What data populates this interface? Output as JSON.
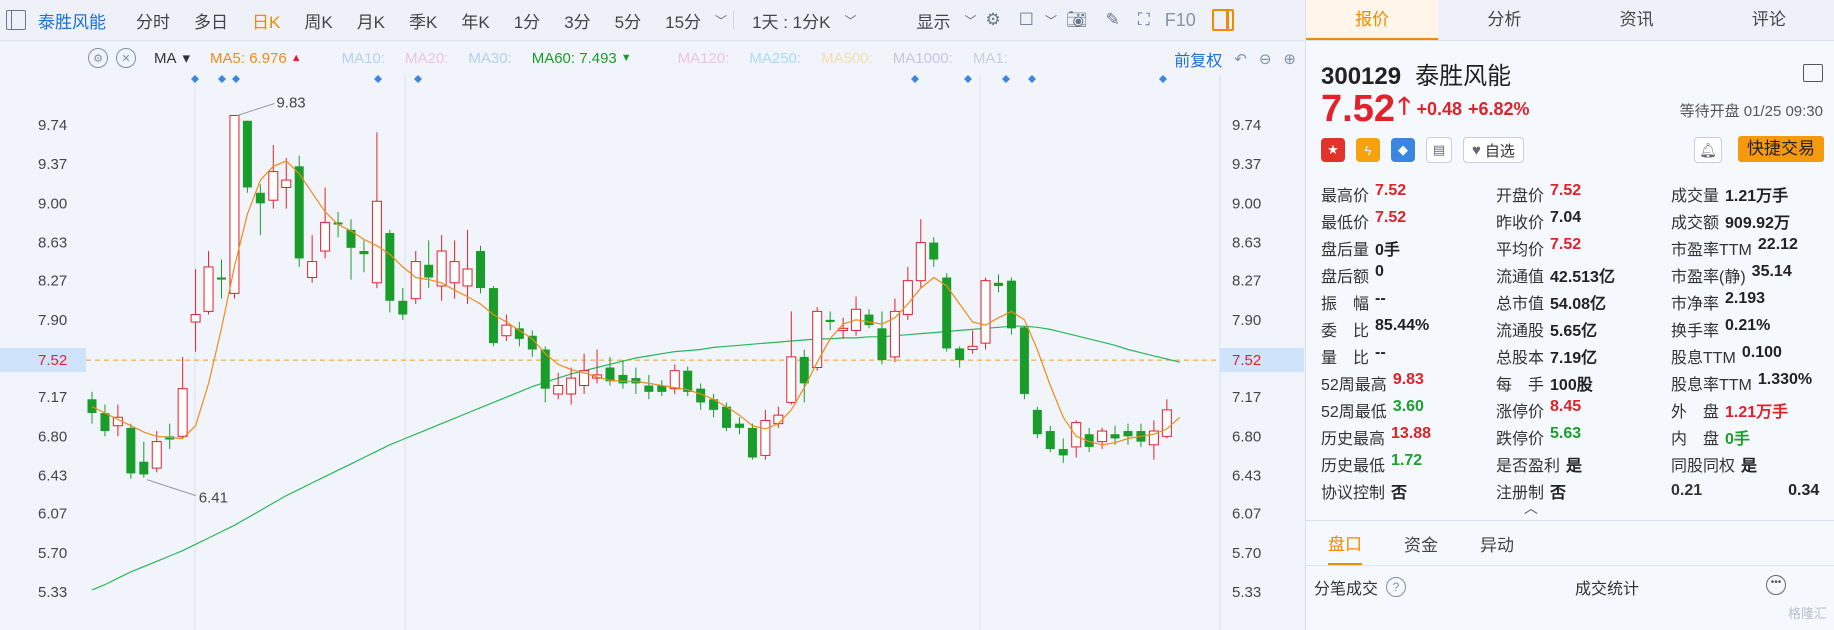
{
  "topbar": {
    "stock_name": "泰胜风能",
    "periods": [
      "分时",
      "多日",
      "日K",
      "周K",
      "月K",
      "季K",
      "年K",
      "1分",
      "3分",
      "5分",
      "15分"
    ],
    "active_period": "日K",
    "range_label": "1天 : 1分K",
    "display_label": "显示",
    "f10_label": "F10"
  },
  "indicator_bar": {
    "type_label": "MA",
    "ma5": "MA5: 6.976",
    "ma10": "MA10:",
    "ma20": "MA20:",
    "ma30": "MA30:",
    "ma60": "MA60: 7.493",
    "ma120": "MA120:",
    "ma250": "MA250:",
    "ma500": "MA500:",
    "ma1000": "MA1000:",
    "ma1x": "MA1:",
    "adjust_label": "前复权"
  },
  "chart_data": {
    "type": "candlestick",
    "y_ticks": [
      "9.74",
      "9.37",
      "9.00",
      "8.63",
      "8.27",
      "7.90",
      "7.52",
      "7.17",
      "6.80",
      "6.43",
      "6.07",
      "5.70",
      "5.33"
    ],
    "ylim": [
      5.33,
      9.74
    ],
    "current_price_label": "7.52",
    "high_annotation": "9.83",
    "low_annotation": "6.41",
    "colors": {
      "up": "#e0222b",
      "down": "#1a9c2a",
      "ma5": "#f08a18",
      "ma60": "#2ab55a"
    },
    "candles": [
      {
        "o": 7.15,
        "c": 7.02,
        "h": 7.22,
        "l": 6.92
      },
      {
        "o": 7.02,
        "c": 6.85,
        "h": 7.1,
        "l": 6.8
      },
      {
        "o": 6.9,
        "c": 6.98,
        "h": 7.1,
        "l": 6.8
      },
      {
        "o": 6.88,
        "c": 6.45,
        "h": 6.92,
        "l": 6.4
      },
      {
        "o": 6.56,
        "c": 6.44,
        "h": 6.75,
        "l": 6.41
      },
      {
        "o": 6.5,
        "c": 6.75,
        "h": 6.85,
        "l": 6.46
      },
      {
        "o": 6.8,
        "c": 6.77,
        "h": 6.92,
        "l": 6.68
      },
      {
        "o": 6.8,
        "c": 7.25,
        "h": 7.55,
        "l": 6.78
      },
      {
        "o": 7.88,
        "c": 7.95,
        "h": 8.38,
        "l": 7.6
      },
      {
        "o": 7.98,
        "c": 8.4,
        "h": 8.55,
        "l": 7.95
      },
      {
        "o": 8.3,
        "c": 8.28,
        "h": 8.47,
        "l": 8.1
      },
      {
        "o": 8.15,
        "c": 9.83,
        "h": 9.83,
        "l": 8.1
      },
      {
        "o": 9.78,
        "c": 9.15,
        "h": 9.78,
        "l": 9.1
      },
      {
        "o": 9.1,
        "c": 9.0,
        "h": 9.18,
        "l": 8.7
      },
      {
        "o": 9.03,
        "c": 9.3,
        "h": 9.55,
        "l": 8.95
      },
      {
        "o": 9.15,
        "c": 9.22,
        "h": 9.43,
        "l": 8.95
      },
      {
        "o": 9.35,
        "c": 8.48,
        "h": 9.45,
        "l": 8.4
      },
      {
        "o": 8.3,
        "c": 8.45,
        "h": 8.7,
        "l": 8.25
      },
      {
        "o": 8.55,
        "c": 8.82,
        "h": 9.15,
        "l": 8.48
      },
      {
        "o": 8.82,
        "c": 8.8,
        "h": 8.92,
        "l": 8.68
      },
      {
        "o": 8.75,
        "c": 8.58,
        "h": 8.85,
        "l": 8.28
      },
      {
        "o": 8.55,
        "c": 8.52,
        "h": 8.65,
        "l": 8.35
      },
      {
        "o": 8.25,
        "c": 9.02,
        "h": 9.67,
        "l": 8.2
      },
      {
        "o": 8.72,
        "c": 8.08,
        "h": 8.75,
        "l": 7.97
      },
      {
        "o": 8.08,
        "c": 7.95,
        "h": 8.2,
        "l": 7.9
      },
      {
        "o": 8.1,
        "c": 8.45,
        "h": 8.55,
        "l": 8.05
      },
      {
        "o": 8.42,
        "c": 8.3,
        "h": 8.65,
        "l": 8.2
      },
      {
        "o": 8.22,
        "c": 8.55,
        "h": 8.7,
        "l": 8.08
      },
      {
        "o": 8.25,
        "c": 8.45,
        "h": 8.65,
        "l": 8.1
      },
      {
        "o": 8.22,
        "c": 8.38,
        "h": 8.75,
        "l": 8.05
      },
      {
        "o": 8.55,
        "c": 8.2,
        "h": 8.6,
        "l": 8.15
      },
      {
        "o": 8.2,
        "c": 7.68,
        "h": 8.22,
        "l": 7.65
      },
      {
        "o": 7.75,
        "c": 7.85,
        "h": 7.95,
        "l": 7.7
      },
      {
        "o": 7.82,
        "c": 7.72,
        "h": 7.88,
        "l": 7.65
      },
      {
        "o": 7.75,
        "c": 7.62,
        "h": 7.8,
        "l": 7.55
      },
      {
        "o": 7.62,
        "c": 7.25,
        "h": 7.65,
        "l": 7.12
      },
      {
        "o": 7.2,
        "c": 7.28,
        "h": 7.4,
        "l": 7.15
      },
      {
        "o": 7.2,
        "c": 7.35,
        "h": 7.45,
        "l": 7.1
      },
      {
        "o": 7.28,
        "c": 7.42,
        "h": 7.58,
        "l": 7.2
      },
      {
        "o": 7.35,
        "c": 7.38,
        "h": 7.62,
        "l": 7.3
      },
      {
        "o": 7.45,
        "c": 7.32,
        "h": 7.55,
        "l": 7.28
      },
      {
        "o": 7.38,
        "c": 7.3,
        "h": 7.52,
        "l": 7.25
      },
      {
        "o": 7.35,
        "c": 7.3,
        "h": 7.45,
        "l": 7.2
      },
      {
        "o": 7.28,
        "c": 7.22,
        "h": 7.38,
        "l": 7.15
      },
      {
        "o": 7.28,
        "c": 7.22,
        "h": 7.33,
        "l": 7.18
      },
      {
        "o": 7.25,
        "c": 7.42,
        "h": 7.48,
        "l": 7.2
      },
      {
        "o": 7.42,
        "c": 7.22,
        "h": 7.46,
        "l": 7.18
      },
      {
        "o": 7.25,
        "c": 7.12,
        "h": 7.3,
        "l": 7.05
      },
      {
        "o": 7.15,
        "c": 7.05,
        "h": 7.2,
        "l": 6.98
      },
      {
        "o": 7.08,
        "c": 6.88,
        "h": 7.12,
        "l": 6.85
      },
      {
        "o": 6.92,
        "c": 6.88,
        "h": 6.98,
        "l": 6.82
      },
      {
        "o": 6.88,
        "c": 6.6,
        "h": 6.92,
        "l": 6.58
      },
      {
        "o": 6.62,
        "c": 6.95,
        "h": 7.05,
        "l": 6.58
      },
      {
        "o": 6.92,
        "c": 7.0,
        "h": 7.08,
        "l": 6.88
      },
      {
        "o": 7.12,
        "c": 7.55,
        "h": 7.98,
        "l": 7.1
      },
      {
        "o": 7.55,
        "c": 7.3,
        "h": 7.62,
        "l": 7.12
      },
      {
        "o": 7.45,
        "c": 7.98,
        "h": 8.02,
        "l": 7.42
      },
      {
        "o": 7.9,
        "c": 7.88,
        "h": 7.98,
        "l": 7.8
      },
      {
        "o": 7.8,
        "c": 7.82,
        "h": 7.92,
        "l": 7.72
      },
      {
        "o": 7.8,
        "c": 8.0,
        "h": 8.12,
        "l": 7.75
      },
      {
        "o": 7.95,
        "c": 7.85,
        "h": 8.0,
        "l": 7.82
      },
      {
        "o": 7.82,
        "c": 7.52,
        "h": 7.98,
        "l": 7.48
      },
      {
        "o": 7.55,
        "c": 7.98,
        "h": 8.1,
        "l": 7.5
      },
      {
        "o": 7.95,
        "c": 8.27,
        "h": 8.4,
        "l": 7.9
      },
      {
        "o": 8.27,
        "c": 8.63,
        "h": 8.85,
        "l": 8.2
      },
      {
        "o": 8.63,
        "c": 8.47,
        "h": 8.68,
        "l": 8.4
      },
      {
        "o": 8.3,
        "c": 7.63,
        "h": 8.34,
        "l": 7.6
      },
      {
        "o": 7.63,
        "c": 7.52,
        "h": 7.65,
        "l": 7.45
      },
      {
        "o": 7.62,
        "c": 7.65,
        "h": 7.8,
        "l": 7.58
      },
      {
        "o": 7.68,
        "c": 8.27,
        "h": 8.3,
        "l": 7.62
      },
      {
        "o": 8.25,
        "c": 8.22,
        "h": 8.33,
        "l": 8.16
      },
      {
        "o": 8.27,
        "c": 7.82,
        "h": 8.3,
        "l": 7.76
      },
      {
        "o": 7.83,
        "c": 7.2,
        "h": 7.84,
        "l": 7.15
      },
      {
        "o": 7.05,
        "c": 6.82,
        "h": 7.08,
        "l": 6.78
      },
      {
        "o": 6.85,
        "c": 6.68,
        "h": 6.9,
        "l": 6.65
      },
      {
        "o": 6.68,
        "c": 6.62,
        "h": 6.78,
        "l": 6.55
      },
      {
        "o": 6.7,
        "c": 6.93,
        "h": 6.95,
        "l": 6.6
      },
      {
        "o": 6.82,
        "c": 6.7,
        "h": 6.88,
        "l": 6.65
      },
      {
        "o": 6.75,
        "c": 6.85,
        "h": 6.88,
        "l": 6.68
      },
      {
        "o": 6.82,
        "c": 6.78,
        "h": 6.9,
        "l": 6.72
      },
      {
        "o": 6.85,
        "c": 6.8,
        "h": 6.92,
        "l": 6.72
      },
      {
        "o": 6.85,
        "c": 6.75,
        "h": 6.92,
        "l": 6.7
      },
      {
        "o": 6.72,
        "c": 6.85,
        "h": 6.95,
        "l": 6.58
      },
      {
        "o": 6.8,
        "c": 7.05,
        "h": 7.15,
        "l": 6.78
      }
    ],
    "ma5_values": [
      7.08,
      7.02,
      6.96,
      6.9,
      6.84,
      6.8,
      6.79,
      6.78,
      6.9,
      7.3,
      7.82,
      8.4,
      8.9,
      9.22,
      9.35,
      9.4,
      9.28,
      9.1,
      8.92,
      8.8,
      8.74,
      8.66,
      8.6,
      8.52,
      8.4,
      8.3,
      8.28,
      8.25,
      8.18,
      8.12,
      8.05,
      7.95,
      7.88,
      7.8,
      7.72,
      7.58,
      7.48,
      7.43,
      7.4,
      7.36,
      7.33,
      7.32,
      7.32,
      7.3,
      7.28,
      7.26,
      7.24,
      7.2,
      7.15,
      7.08,
      7.0,
      6.9,
      6.87,
      6.92,
      7.05,
      7.26,
      7.5,
      7.72,
      7.86,
      7.9,
      7.88,
      7.86,
      7.92,
      8.05,
      8.2,
      8.3,
      8.22,
      8.05,
      7.88,
      7.85,
      7.92,
      7.98,
      7.9,
      7.62,
      7.28,
      6.98,
      6.8,
      6.75,
      6.72,
      6.74,
      6.78,
      6.8,
      6.82,
      6.87,
      6.98
    ],
    "ma60_values": [
      5.35,
      5.4,
      5.46,
      5.52,
      5.57,
      5.62,
      5.67,
      5.72,
      5.78,
      5.84,
      5.9,
      5.96,
      6.03,
      6.1,
      6.17,
      6.24,
      6.3,
      6.36,
      6.42,
      6.48,
      6.54,
      6.6,
      6.66,
      6.72,
      6.77,
      6.82,
      6.87,
      6.92,
      6.97,
      7.02,
      7.07,
      7.12,
      7.17,
      7.22,
      7.27,
      7.31,
      7.35,
      7.39,
      7.42,
      7.45,
      7.48,
      7.51,
      7.54,
      7.56,
      7.58,
      7.6,
      7.61,
      7.62,
      7.64,
      7.65,
      7.66,
      7.67,
      7.68,
      7.69,
      7.7,
      7.71,
      7.72,
      7.72,
      7.73,
      7.73,
      7.74,
      7.74,
      7.75,
      7.76,
      7.77,
      7.78,
      7.79,
      7.8,
      7.81,
      7.82,
      7.83,
      7.84,
      7.84,
      7.83,
      7.81,
      7.78,
      7.75,
      7.72,
      7.69,
      7.66,
      7.62,
      7.59,
      7.56,
      7.53,
      7.5
    ]
  },
  "sidebar": {
    "tabs": [
      "报价",
      "分析",
      "资讯",
      "评论"
    ],
    "code": "300129",
    "name": "泰胜风能",
    "price": "7.52",
    "change": "+0.48",
    "change_pct": "+6.82%",
    "status": "等待开盘 01/25 09:30",
    "fav_label": "自选",
    "quick_trade": "快捷交易",
    "quote_rows": [
      [
        {
          "l": "最高价",
          "v": "7.52",
          "c": "red"
        },
        {
          "l": "开盘价",
          "v": "7.52",
          "c": "red"
        },
        {
          "l": "成交量",
          "v": "1.21万手",
          "c": ""
        }
      ],
      [
        {
          "l": "最低价",
          "v": "7.52",
          "c": "red"
        },
        {
          "l": "昨收价",
          "v": "7.04",
          "c": ""
        },
        {
          "l": "成交额",
          "v": "909.92万",
          "c": ""
        }
      ],
      [
        {
          "l": "盘后量",
          "v": "0手",
          "c": ""
        },
        {
          "l": "平均价",
          "v": "7.52",
          "c": "red"
        },
        {
          "l": "市盈率TTM",
          "v": "22.12",
          "c": ""
        }
      ],
      [
        {
          "l": "盘后额",
          "v": "0",
          "c": ""
        },
        {
          "l": "流通值",
          "v": "42.513亿",
          "c": ""
        },
        {
          "l": "市盈率(静)",
          "v": "35.14",
          "c": ""
        }
      ],
      [
        {
          "l": "振　幅",
          "v": "--",
          "c": ""
        },
        {
          "l": "总市值",
          "v": "54.08亿",
          "c": ""
        },
        {
          "l": "市净率",
          "v": "2.193",
          "c": ""
        }
      ],
      [
        {
          "l": "委　比",
          "v": "85.44%",
          "c": ""
        },
        {
          "l": "流通股",
          "v": "5.65亿",
          "c": ""
        },
        {
          "l": "换手率",
          "v": "0.21%",
          "c": ""
        }
      ],
      [
        {
          "l": "量　比",
          "v": "--",
          "c": ""
        },
        {
          "l": "总股本",
          "v": "7.19亿",
          "c": ""
        },
        {
          "l": "股息TTM",
          "v": "0.100",
          "c": ""
        }
      ],
      [
        {
          "l": "52周最高",
          "v": "9.83",
          "c": "red"
        },
        {
          "l": "每　手",
          "v": "100股",
          "c": ""
        },
        {
          "l": "股息率TTM",
          "v": "1.330%",
          "c": ""
        }
      ],
      [
        {
          "l": "52周最低",
          "v": "3.60",
          "c": "green"
        },
        {
          "l": "涨停价",
          "v": "8.45",
          "c": "red"
        },
        {
          "l": "外　盘",
          "v": "1.21万手",
          "c": "red"
        }
      ],
      [
        {
          "l": "历史最高",
          "v": "13.88",
          "c": "red"
        },
        {
          "l": "跌停价",
          "v": "5.63",
          "c": "green"
        },
        {
          "l": "内　盘",
          "v": "0手",
          "c": "green"
        }
      ],
      [
        {
          "l": "历史最低",
          "v": "1.72",
          "c": "green"
        },
        {
          "l": "是否盈利",
          "v": "是",
          "c": ""
        },
        {
          "l": "同股同权",
          "v": "是",
          "c": ""
        }
      ],
      [
        {
          "l": "协议控制",
          "v": "否",
          "c": ""
        },
        {
          "l": "注册制",
          "v": "否",
          "c": ""
        },
        {
          "l": "0.21",
          "v": "0.34",
          "c": ""
        }
      ]
    ],
    "bottom_tabs": [
      "盘口",
      "资金",
      "异动"
    ],
    "trades_label": "分笔成交",
    "stats_label": "成交统计",
    "brand": "格隆汇"
  }
}
